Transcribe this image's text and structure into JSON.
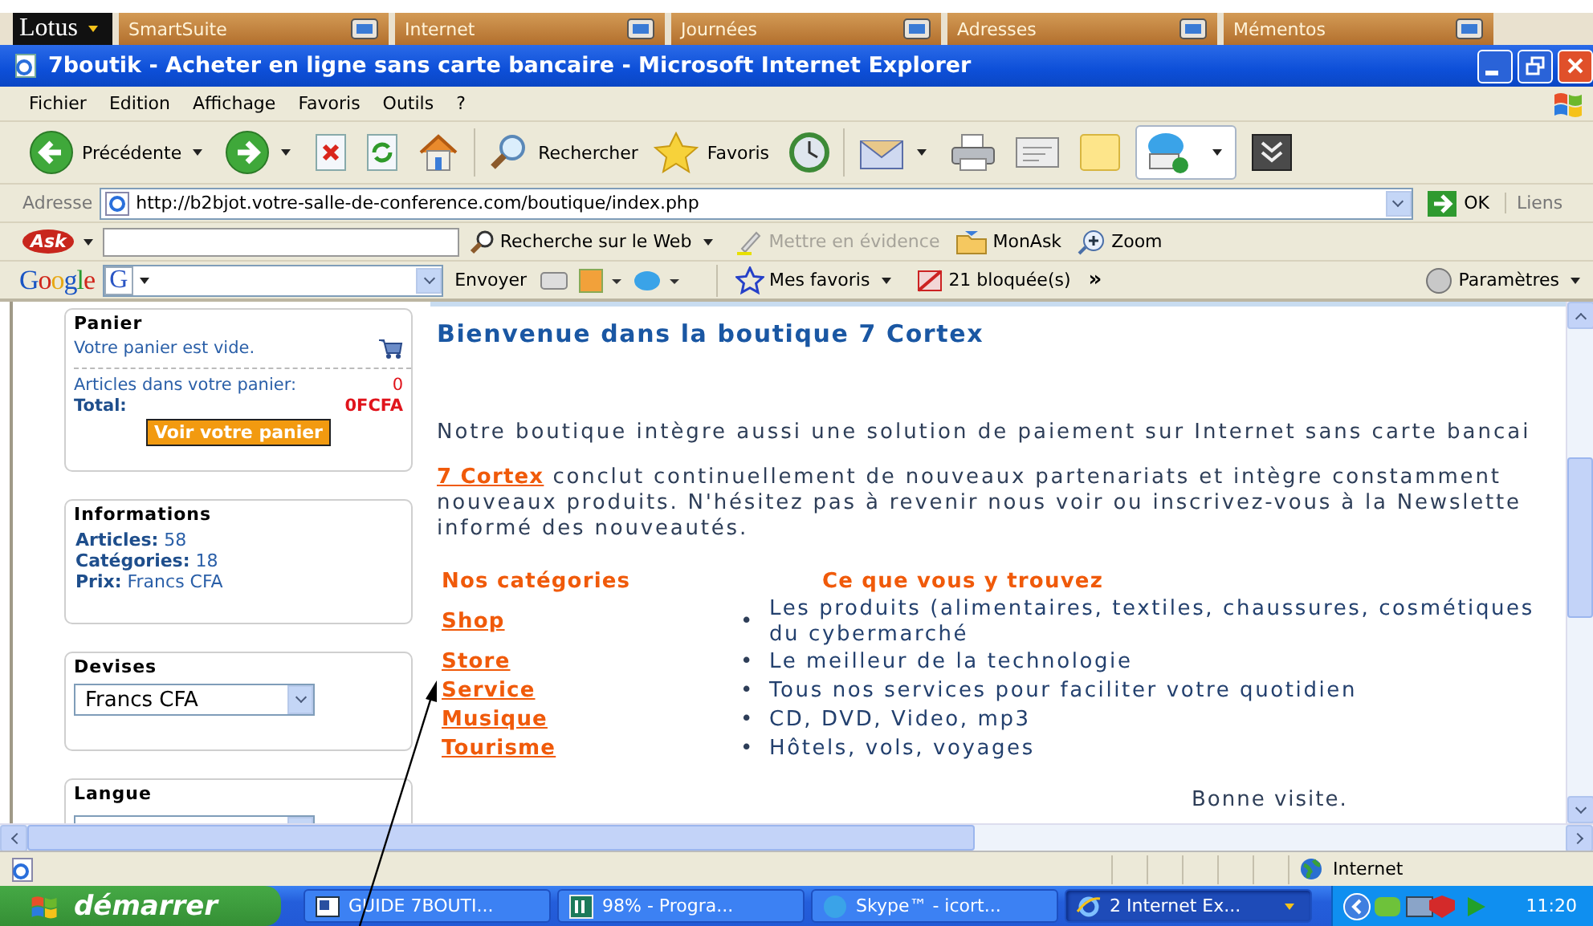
{
  "lotus_bar": {
    "logo": "Lotus",
    "items": [
      "SmartSuite",
      "Internet",
      "Journées",
      "Adresses",
      "Mémentos"
    ]
  },
  "window": {
    "title": "7boutik - Acheter en ligne sans carte bancaire - Microsoft Internet Explorer"
  },
  "menu": [
    "Fichier",
    "Edition",
    "Affichage",
    "Favoris",
    "Outils",
    "?"
  ],
  "toolbar": [
    {
      "kind": "back",
      "label": "Précédente",
      "dropdown": true
    },
    {
      "kind": "forward",
      "dropdown": true
    },
    {
      "kind": "stop",
      "dropdown": false
    },
    {
      "kind": "refresh",
      "dropdown": false
    },
    {
      "kind": "home",
      "dropdown": false
    },
    {
      "kind": "search",
      "label": "Rechercher",
      "dropdown": false
    },
    {
      "kind": "favorites",
      "label": "Favoris",
      "dropdown": false
    },
    {
      "kind": "history",
      "dropdown": false
    },
    {
      "kind": "mail",
      "dropdown": true
    },
    {
      "kind": "print",
      "dropdown": false
    },
    {
      "kind": "edit",
      "dropdown": false
    },
    {
      "kind": "note",
      "dropdown": false
    },
    {
      "kind": "skype",
      "dropdown": true
    },
    {
      "kind": "extra",
      "dropdown": false
    }
  ],
  "address_bar": {
    "label": "Adresse",
    "url": "http://b2bjot.votre-salle-de-conference.com/boutique/index.php",
    "go": "OK",
    "links": "Liens"
  },
  "ask_bar": {
    "logo": "Ask",
    "search_button": "Recherche sur le Web",
    "highlight": {
      "label": "Mettre en évidence",
      "disabled": true
    },
    "monask": "MonAsk",
    "zoom": "Zoom"
  },
  "google_bar": {
    "logo": "Google",
    "engine_mark": "G",
    "send": "Envoyer",
    "favorites": "Mes favoris",
    "blocked": "21 bloquée(s)",
    "more": "»",
    "settings": "Paramètres"
  },
  "sidebar": {
    "cart": {
      "title": "Panier",
      "empty": "Votre panier est vide.",
      "items_label": "Articles dans votre panier:",
      "items_value": "0",
      "total_label": "Total:",
      "total_value": "0FCFA",
      "button": "Voir votre panier"
    },
    "info": {
      "title": "Informations",
      "rows": [
        {
          "label": "Articles:",
          "value": "58"
        },
        {
          "label": "Catégories:",
          "value": "18"
        },
        {
          "label": "Prix:",
          "value": "Francs CFA"
        }
      ]
    },
    "currency": {
      "title": "Devises",
      "value": "Francs CFA"
    },
    "language": {
      "title": "Langue"
    }
  },
  "content": {
    "heading": "Bienvenue dans la boutique 7 Cortex",
    "intro": "Notre boutique intègre aussi une solution de paiement sur Internet sans carte bancai",
    "paragraph": {
      "link": "7 Cortex",
      "lines": [
        " conclut continuellement de nouveaux partenariats et intègre constamment",
        "nouveaux produits. N'hésitez pas à revenir nous voir ou inscrivez-vous à la Newslette",
        "informé des nouveautés."
      ]
    },
    "categories_header": "Nos catégories",
    "description_header": "Ce que vous y trouvez",
    "categories": [
      {
        "name": "Shop",
        "bullet": "•",
        "lines": [
          "Les produits (alimentaires, textiles, chaussures, cosmétiques",
          "du cybermarché"
        ]
      },
      {
        "name": "Store",
        "bullet": "•",
        "lines": [
          "Le meilleur de la technologie"
        ]
      },
      {
        "name": "Service",
        "bullet": "•",
        "lines": [
          "Tous nos services pour faciliter votre quotidien"
        ]
      },
      {
        "name": "Musique",
        "bullet": "•",
        "lines": [
          "CD, DVD, Video, mp3"
        ]
      },
      {
        "name": "Tourisme",
        "bullet": "•",
        "lines": [
          "Hôtels, vols, voyages"
        ]
      }
    ],
    "closing": "Bonne visite."
  },
  "status_bar": {
    "zone": "Internet"
  },
  "taskbar": {
    "start": "démarrer",
    "tasks": [
      {
        "label": "GUIDE 7BOUTI...",
        "kind": "word",
        "selected": false
      },
      {
        "label": "98% - Progra...",
        "kind": "progress",
        "selected": false
      },
      {
        "label": "Skype™ - icort...",
        "kind": "skype",
        "selected": false
      },
      {
        "label": "2 Internet Ex...",
        "kind": "ie",
        "selected": true
      }
    ],
    "clock": "11:20"
  }
}
